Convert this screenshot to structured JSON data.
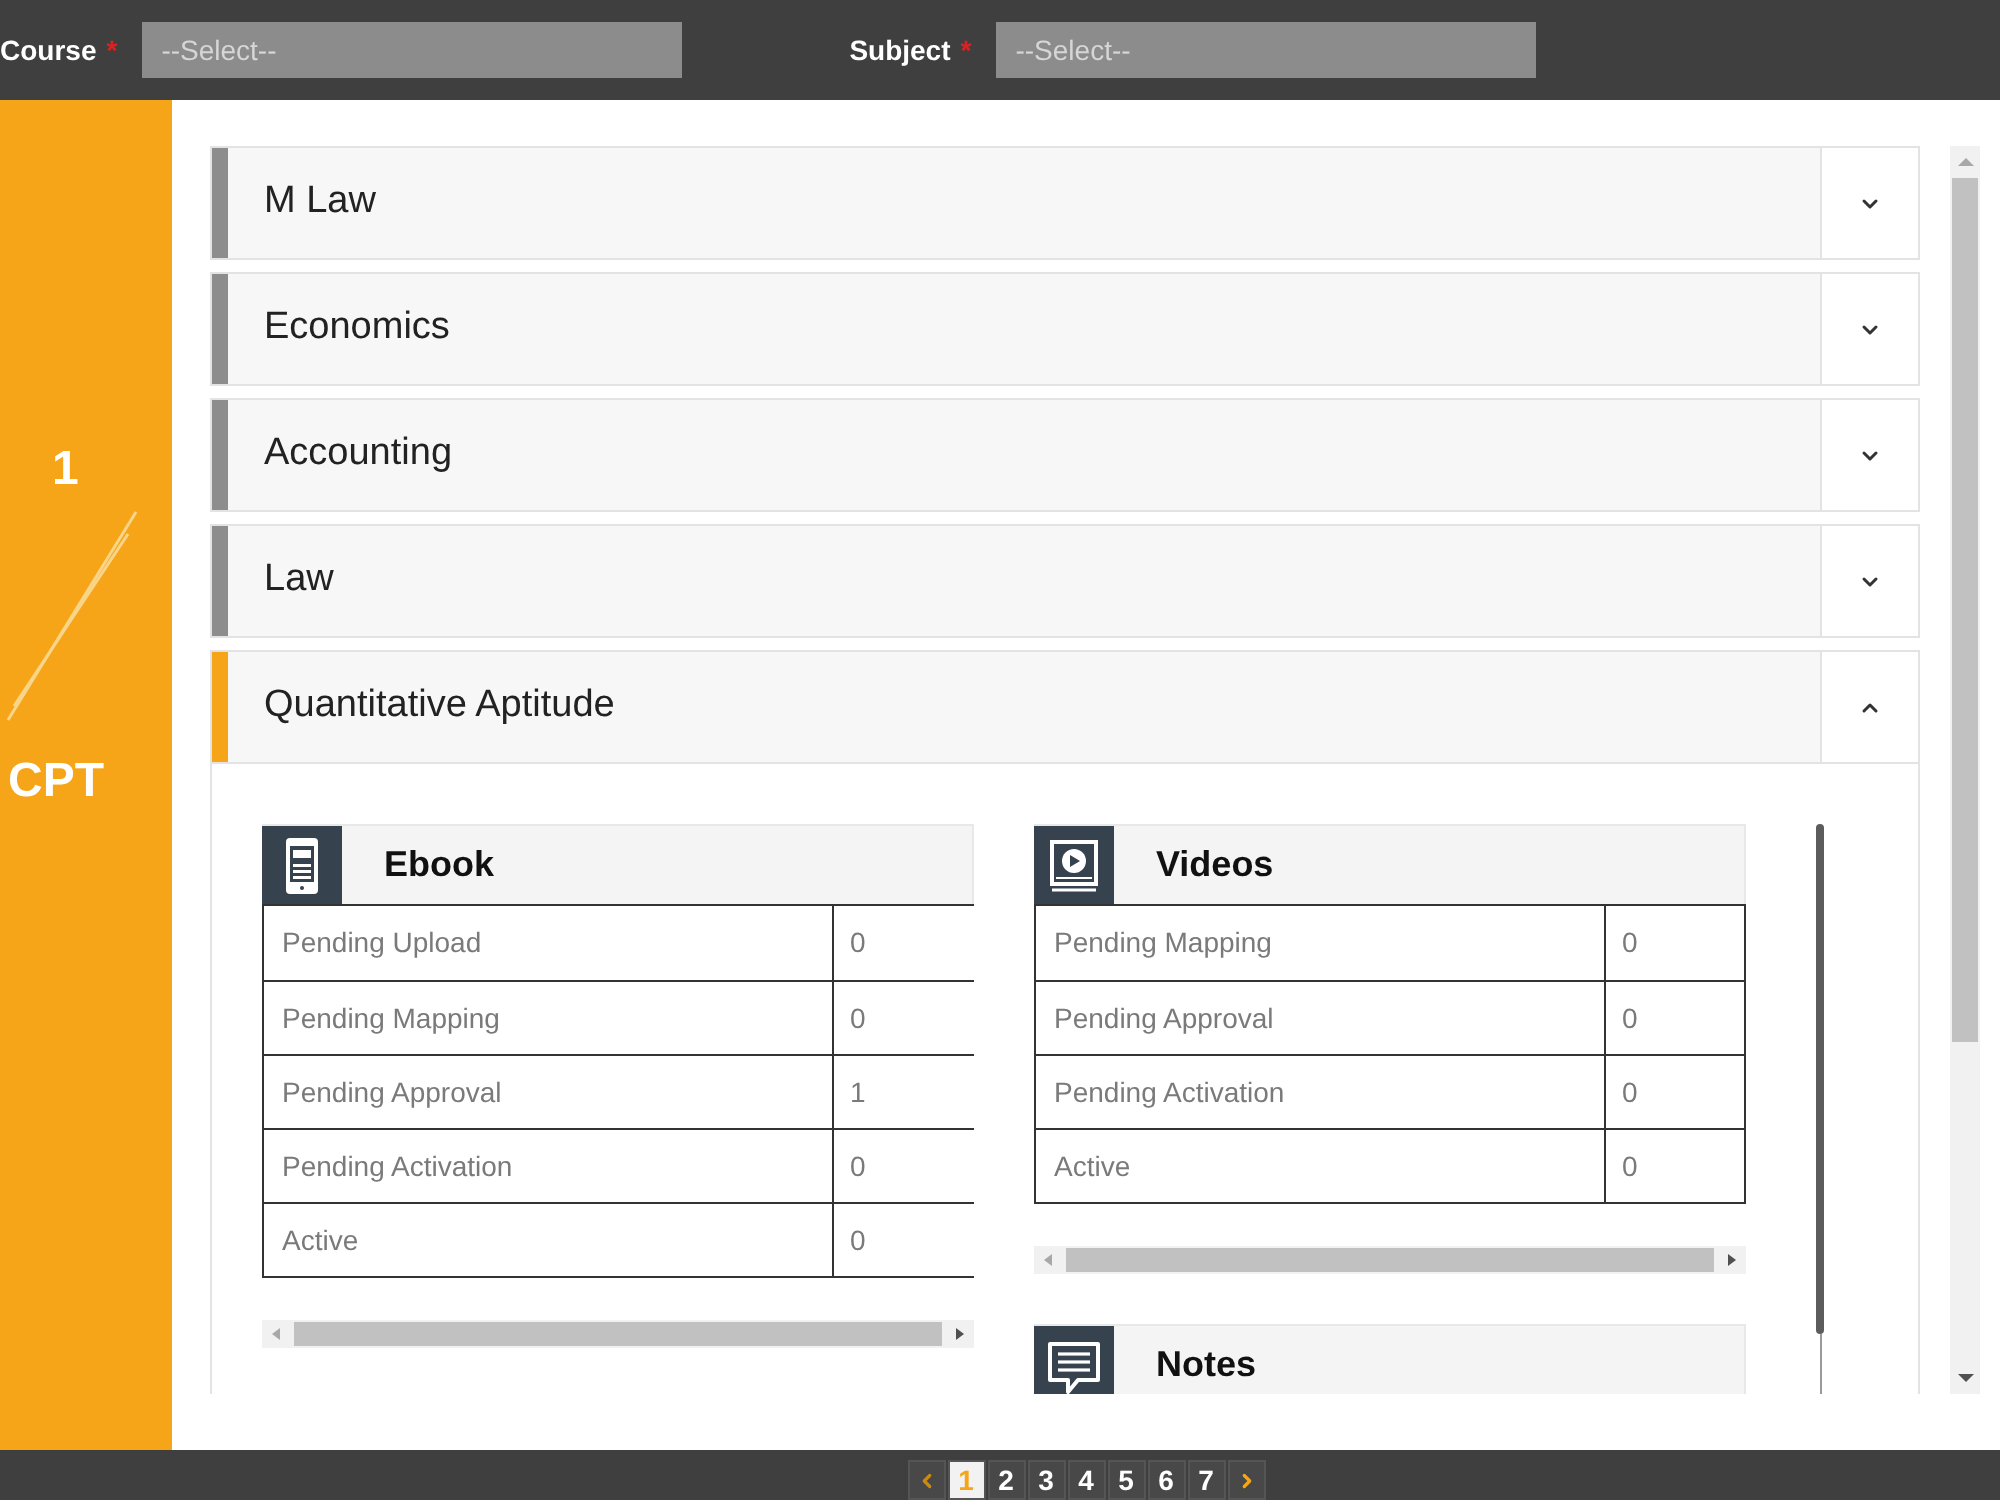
{
  "filters": [
    {
      "label": "Course",
      "required_mark": "*",
      "placeholder": "--Select--"
    },
    {
      "label": "Subject",
      "required_mark": "*",
      "placeholder": "--Select--"
    }
  ],
  "sidebar": {
    "number": "1",
    "label": "CPT"
  },
  "accordion": [
    {
      "title": "M Law",
      "expanded": false
    },
    {
      "title": "Economics",
      "expanded": false
    },
    {
      "title": "Accounting",
      "expanded": false
    },
    {
      "title": "Law",
      "expanded": false
    },
    {
      "title": "Quantitative Aptitude",
      "expanded": true,
      "panels": [
        {
          "kind": "ebook",
          "title": "Ebook",
          "rows": [
            {
              "label": "Pending Upload",
              "value": "0"
            },
            {
              "label": "Pending Mapping",
              "value": "0"
            },
            {
              "label": "Pending Approval",
              "value": "1"
            },
            {
              "label": "Pending Activation",
              "value": "0"
            },
            {
              "label": "Active",
              "value": "0"
            }
          ]
        },
        {
          "kind": "video",
          "title": "Videos",
          "rows": [
            {
              "label": "Pending Mapping",
              "value": "0"
            },
            {
              "label": "Pending Approval",
              "value": "0"
            },
            {
              "label": "Pending Activation",
              "value": "0"
            },
            {
              "label": "Active",
              "value": "0"
            }
          ]
        },
        {
          "kind": "notes",
          "title": "Notes"
        }
      ]
    }
  ],
  "pagination": {
    "pages": [
      {
        "label": "1",
        "selected": true
      },
      {
        "label": "2",
        "selected": false
      },
      {
        "label": "3",
        "selected": false
      },
      {
        "label": "4",
        "selected": false
      },
      {
        "label": "5",
        "selected": false
      },
      {
        "label": "6",
        "selected": false
      },
      {
        "label": "7",
        "selected": false
      }
    ]
  }
}
